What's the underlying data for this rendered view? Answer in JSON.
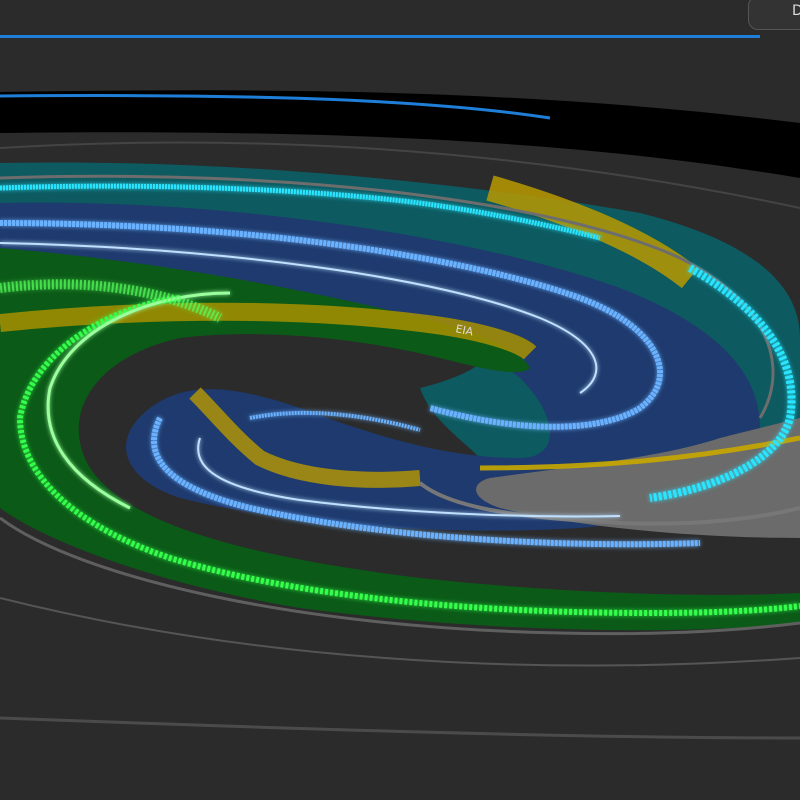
{
  "app": {
    "tab_label": "D"
  },
  "scene": {
    "description_visible_text": [
      "…",
      "EIA"
    ],
    "colors": {
      "background": "#2b2b2b",
      "dark_band": "#000000",
      "accent_blue": "#1f7fd8",
      "teal_band": "#0d5a60",
      "navy_band": "#1e3a6e",
      "green_band": "#0b5a17",
      "gold_track": "#d4b000",
      "cyan_trace": "#29e5ff",
      "light_blue_trace": "#6ab2ff",
      "green_trace": "#34ff4c",
      "grey_outline": "#6b6b6b"
    },
    "icons": [
      "spiral-track-view"
    ]
  }
}
